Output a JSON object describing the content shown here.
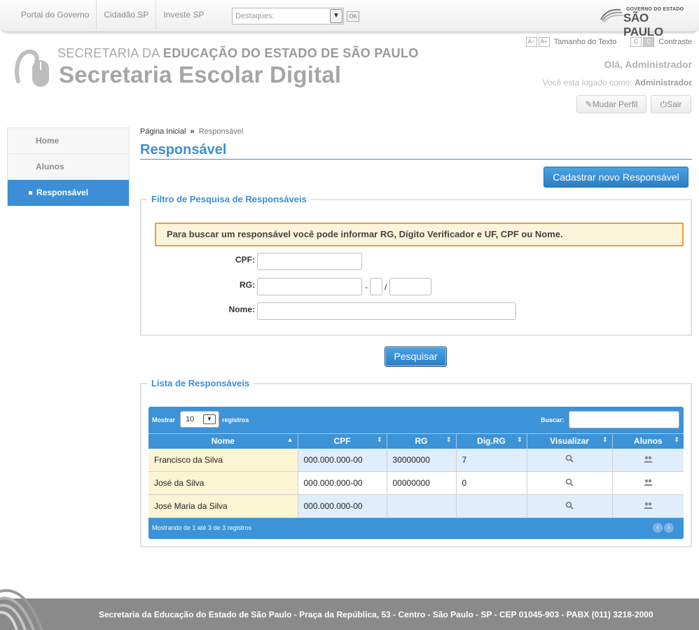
{
  "gov_bar": {
    "links": [
      "Portal do Governo",
      "Cidadão.SP",
      "Investe SP"
    ],
    "destaques_placeholder": "Destaques:",
    "ok_label": "OK",
    "logo_small": "GOVERNO DO ESTADO",
    "logo_big": "SÃO PAULO"
  },
  "header": {
    "line1_light": "SECRETARIA DA",
    "line1_bold": "EDUCAÇÃO DO ESTADO DE SÃO PAULO",
    "line2": "Secretaria Escolar Digital",
    "font_decrease": "A−",
    "font_increase": "A+",
    "text_size_label": "Tamanho do Texto",
    "contrast_c1": "C",
    "contrast_c2": "C",
    "contrast_label": "Contraste",
    "greeting": "Olá, Administrador",
    "logged_prefix": "Você esta logado como:",
    "logged_role": "Administrador",
    "change_profile": "Mudar Perfil",
    "logout": "Sair"
  },
  "sidebar": {
    "items": [
      {
        "label": "Home"
      },
      {
        "label": "Alunos"
      },
      {
        "label": "Responsável"
      }
    ]
  },
  "breadcrumb": {
    "home": "Página Inicial",
    "separator": "»",
    "current": "Responsável"
  },
  "page": {
    "title": "Responsável",
    "new_button": "Cadastrar novo Responsável"
  },
  "filter": {
    "legend": "Filtro de Pesquisa de Responsáveis",
    "notice": "Para buscar um responsável você pode informar RG, Dígito Verificador e UF, CPF ou Nome.",
    "cpf_label": "CPF:",
    "rg_label": "RG:",
    "rg_dash": "-",
    "rg_slash": "/",
    "name_label": "Nome:",
    "search_button": "Pesquisar"
  },
  "list": {
    "legend": "Lista de Responsáveis",
    "show_label": "Mostrar",
    "page_size": "10",
    "records_label": "registros",
    "search_label": "Buscar:",
    "columns": [
      "Nome",
      "CPF",
      "RG",
      "Dig.RG",
      "Visualizar",
      "Alunos"
    ],
    "rows": [
      {
        "nome": "Francisco da Silva",
        "cpf": "000.000.000-00",
        "rg": "30000000",
        "dig": "7"
      },
      {
        "nome": "José da Silva",
        "cpf": "000.000.000-00",
        "rg": "00000000",
        "dig": "0"
      },
      {
        "nome": "José Maria da Silva",
        "cpf": "000.000.000-00",
        "rg": "",
        "dig": ""
      }
    ],
    "footer_info": "Mostrando de 1 até 3 de 3 registros"
  },
  "footer": {
    "text": "Secretaria da Educação do Estado de São Paulo - Praça da República, 53 - Centro - São Paulo - SP - CEP 01045-903 - PABX (011) 3218-2000"
  },
  "colors": {
    "accent": "#3c8fd6",
    "notice_border": "#e8a22a",
    "notice_bg": "#fdf4dc",
    "footer": "#8a8a8a"
  },
  "icons": {
    "view": "search-icon",
    "students": "users-icon",
    "profile": "wrench-icon",
    "logout": "power-icon"
  }
}
